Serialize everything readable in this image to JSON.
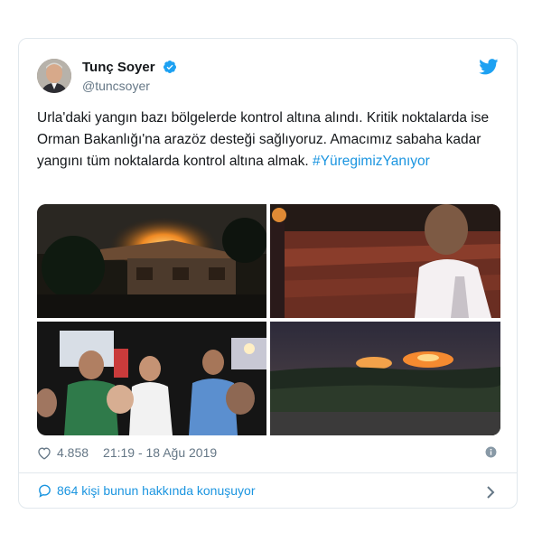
{
  "author": {
    "name": "Tunç Soyer",
    "handle": "@tuncsoyer"
  },
  "tweet": {
    "text_plain": "Urla'daki yangın bazı bölgelerde kontrol altına alındı. Kritik noktalarda ise Orman Bakanlığı'na arazöz desteği sağlıyoruz. Amacımız sabaha kadar yangını tüm noktalarda kontrol altına almak. ",
    "hashtag": "#YüregimizYanıyor"
  },
  "stats": {
    "likes": "4.858",
    "timestamp": "21:19 - 18 Ağu 2019"
  },
  "conversation": {
    "label": "864 kişi bunun hakkında konuşuyor"
  },
  "colors": {
    "link": "#1b95e0",
    "muted": "#657786",
    "border": "#e1e8ed"
  }
}
